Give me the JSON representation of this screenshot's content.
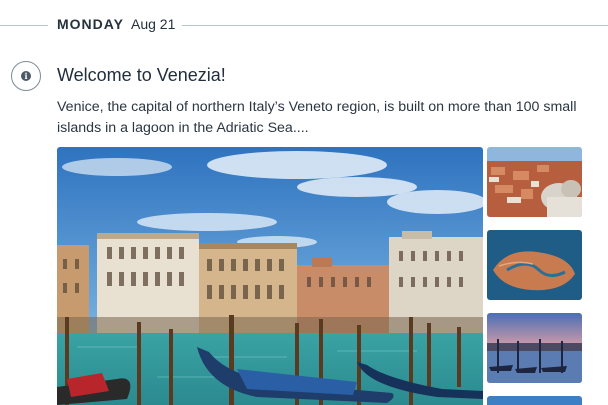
{
  "day_header": {
    "day": "MONDAY",
    "date": "Aug 21"
  },
  "card": {
    "icon": "info-icon",
    "title": "Welcome to Venezia!",
    "description": "Venice, the capital of northern Italy’s Veneto region, is built on more than 100 small islands in a lagoon in the Adriatic Sea...."
  },
  "gallery": {
    "main_image": "venice-grand-canal-gondolas-photo",
    "thumbnails": [
      "venice-rooftops-basilica-photo",
      "venice-aerial-lagoon-photo",
      "venice-gondolas-dusk-photo",
      "venice-thumbnail-partial"
    ]
  },
  "colors": {
    "rule": "#b7c3cf",
    "icon_border": "#7d8b99",
    "text": "#1f2d3d"
  }
}
